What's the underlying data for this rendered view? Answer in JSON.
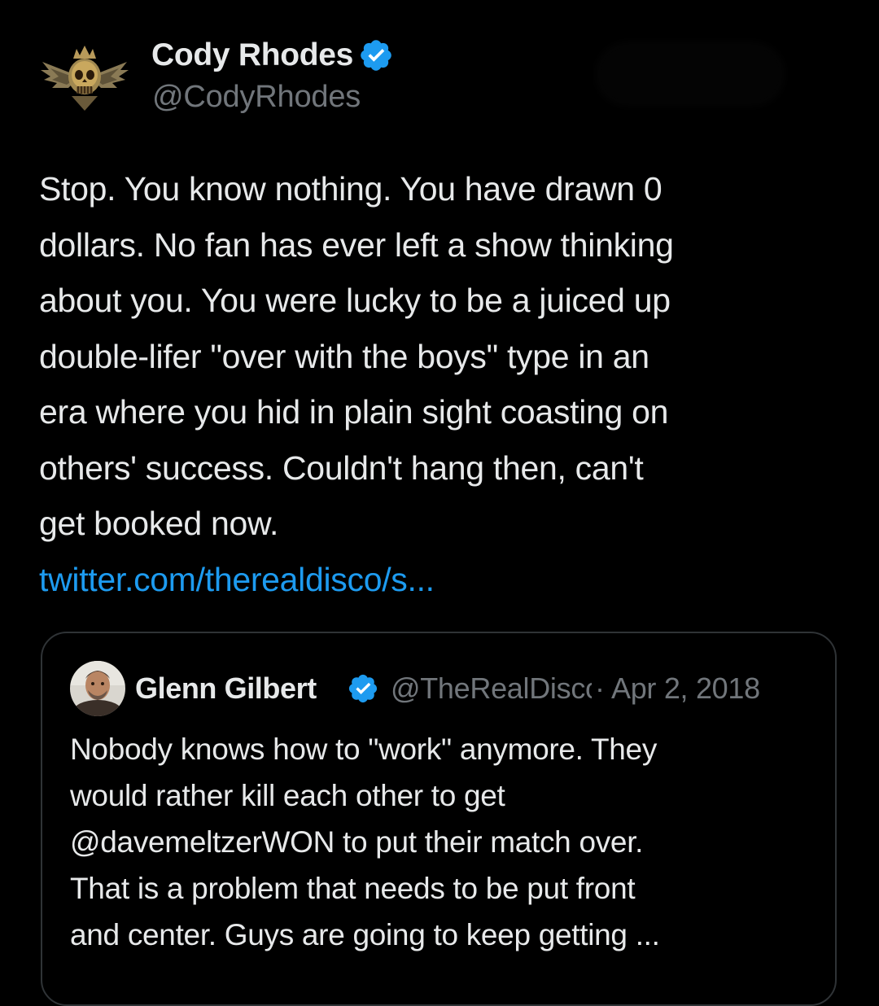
{
  "author": {
    "display_name": "Cody Rhodes",
    "handle": "@CodyRhodes",
    "avatar_icon": "winged-skull-crest-icon",
    "verified_icon": "verified-badge-icon"
  },
  "tweet": {
    "lines": [
      "Stop. You know nothing. You have drawn 0",
      "dollars. No fan has ever left a show thinking",
      "about you. You were lucky to be a juiced up",
      "double-lifer \"over with the boys\" type in an",
      "era where you hid in plain sight coasting on",
      "others' success. Couldn't hang then, can't",
      "get booked now."
    ],
    "link": "twitter.com/therealdisco/s..."
  },
  "quoted_tweet": {
    "display_name": "Glenn Gilbert",
    "handle": "@TheRealDisco",
    "separator": "·",
    "date": "Apr 2, 2018",
    "avatar_icon": "profile-photo",
    "verified_icon": "verified-badge-icon",
    "lines": [
      "Nobody knows how to \"work\" anymore.  They",
      "would rather kill each other to get",
      "@davemeltzerWON to put their match over.",
      "That is a problem that needs to be put front",
      "and center.  Guys are going to keep getting ..."
    ]
  },
  "colors": {
    "background": "#000000",
    "text_primary": "#e7e9ea",
    "text_secondary": "#71767b",
    "link": "#1d9bf0",
    "verified": "#1d9bf0",
    "border": "#2f3336"
  }
}
